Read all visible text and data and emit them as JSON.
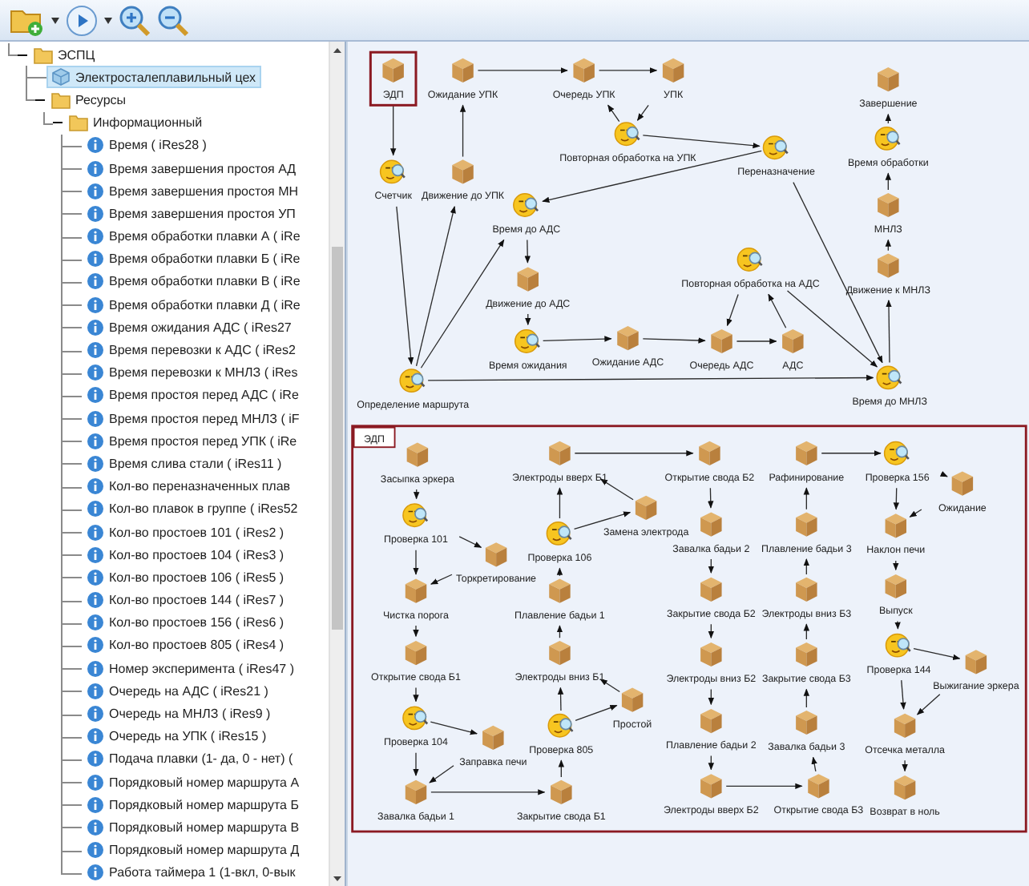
{
  "tree": [
    {
      "label": "ЭСПЦ",
      "kind": "folder",
      "expanded": true,
      "selected": false,
      "children": [
        {
          "label": "Электросталеплавильный цех",
          "kind": "shop",
          "selected": true
        },
        {
          "label": "Ресурсы",
          "kind": "folder",
          "expanded": true,
          "selected": false,
          "children": [
            {
              "label": "Информационный",
              "kind": "folder",
              "expanded": true,
              "selected": false,
              "children": [
                {
                  "label": "Время ( iRes28 )",
                  "kind": "info",
                  "selected": false
                },
                {
                  "label": "Время завершения простоя АД",
                  "kind": "info",
                  "selected": false
                },
                {
                  "label": "Время завершения простоя МН",
                  "kind": "info",
                  "selected": false
                },
                {
                  "label": "Время завершения простоя УП",
                  "kind": "info",
                  "selected": false
                },
                {
                  "label": "Время обработки плавки А ( iRe",
                  "kind": "info",
                  "selected": false
                },
                {
                  "label": "Время обработки плавки Б ( iRe",
                  "kind": "info",
                  "selected": false
                },
                {
                  "label": "Время обработки плавки В ( iRe",
                  "kind": "info",
                  "selected": false
                },
                {
                  "label": "Время обработки плавки Д ( iRe",
                  "kind": "info",
                  "selected": false
                },
                {
                  "label": "Время ожидания АДС ( iRes27",
                  "kind": "info",
                  "selected": false
                },
                {
                  "label": "Время перевозки к АДС ( iRes2",
                  "kind": "info",
                  "selected": false
                },
                {
                  "label": "Время перевозки к МНЛЗ ( iRes",
                  "kind": "info",
                  "selected": false
                },
                {
                  "label": "Время простоя перед АДС ( iRe",
                  "kind": "info",
                  "selected": false
                },
                {
                  "label": "Время простоя перед МНЛЗ ( iF",
                  "kind": "info",
                  "selected": false
                },
                {
                  "label": "Время простоя перед УПК ( iRe",
                  "kind": "info",
                  "selected": false
                },
                {
                  "label": "Время слива стали ( iRes11 )",
                  "kind": "info",
                  "selected": false
                },
                {
                  "label": "Кол-во переназначенных плав",
                  "kind": "info",
                  "selected": false
                },
                {
                  "label": "Кол-во плавок в группе ( iRes52",
                  "kind": "info",
                  "selected": false
                },
                {
                  "label": "Кол-во простоев 101 ( iRes2 )",
                  "kind": "info",
                  "selected": false
                },
                {
                  "label": "Кол-во простоев 104 ( iRes3 )",
                  "kind": "info",
                  "selected": false
                },
                {
                  "label": "Кол-во простоев 106 ( iRes5 )",
                  "kind": "info",
                  "selected": false
                },
                {
                  "label": "Кол-во простоев 144 ( iRes7 )",
                  "kind": "info",
                  "selected": false
                },
                {
                  "label": "Кол-во простоев 156 ( iRes6 )",
                  "kind": "info",
                  "selected": false
                },
                {
                  "label": "Кол-во простоев 805 ( iRes4 )",
                  "kind": "info",
                  "selected": false
                },
                {
                  "label": "Номер эксперимента ( iRes47 )",
                  "kind": "info",
                  "selected": false
                },
                {
                  "label": "Очередь на АДС ( iRes21 )",
                  "kind": "info",
                  "selected": false
                },
                {
                  "label": "Очередь на МНЛЗ ( iRes9 )",
                  "kind": "info",
                  "selected": false
                },
                {
                  "label": "Очередь на УПК ( iRes15 )",
                  "kind": "info",
                  "selected": false
                },
                {
                  "label": "Подача плавки (1- да, 0 - нет) (",
                  "kind": "info",
                  "selected": false
                },
                {
                  "label": "Порядковый номер маршрута А",
                  "kind": "info",
                  "selected": false
                },
                {
                  "label": "Порядковый номер маршрута Б",
                  "kind": "info",
                  "selected": false
                },
                {
                  "label": "Порядковый номер маршрута В",
                  "kind": "info",
                  "selected": false
                },
                {
                  "label": "Порядковый номер маршрута Д",
                  "kind": "info",
                  "selected": false
                },
                {
                  "label": "Работа таймера 1 (1-вкл, 0-вык",
                  "kind": "info",
                  "selected": false
                }
              ]
            }
          ]
        }
      ]
    }
  ],
  "top_diagram": {
    "nodes": [
      {
        "label": "ЭДП",
        "kind": "box",
        "selected": true
      },
      {
        "label": "Ожидание УПК",
        "kind": "box",
        "selected": false
      },
      {
        "label": "Очередь УПК",
        "kind": "box",
        "selected": false
      },
      {
        "label": "УПК",
        "kind": "box",
        "selected": false
      },
      {
        "label": "Повторная обработка на УПК",
        "kind": "check",
        "selected": false
      },
      {
        "label": "Счетчик",
        "kind": "check",
        "selected": false
      },
      {
        "label": "Движение до УПК",
        "kind": "box",
        "selected": false
      },
      {
        "label": "Время до АДС",
        "kind": "check",
        "selected": false
      },
      {
        "label": "Движение до АДС",
        "kind": "box",
        "selected": false
      },
      {
        "label": "Время ожидания",
        "kind": "check",
        "selected": false
      },
      {
        "label": "Ожидание АДС",
        "kind": "box",
        "selected": false
      },
      {
        "label": "Определение маршрута",
        "kind": "check",
        "selected": false
      },
      {
        "label": "Переназначение",
        "kind": "check",
        "selected": false
      },
      {
        "label": "Повторная обработка на АДС",
        "kind": "check",
        "selected": false
      },
      {
        "label": "Очередь АДС",
        "kind": "box",
        "selected": false
      },
      {
        "label": "АДС",
        "kind": "box",
        "selected": false
      },
      {
        "label": "Завершение",
        "kind": "box",
        "selected": false
      },
      {
        "label": "Время обработки",
        "kind": "check",
        "selected": false
      },
      {
        "label": "МНЛЗ",
        "kind": "box",
        "selected": false
      },
      {
        "label": "Движение к МНЛЗ",
        "kind": "box",
        "selected": false
      },
      {
        "label": "Время до МНЛЗ",
        "kind": "check",
        "selected": false
      }
    ]
  },
  "group": {
    "title": "ЭДП",
    "nodes": [
      {
        "label": "Засыпка эркера",
        "kind": "box",
        "selected": false
      },
      {
        "label": "Проверка 101",
        "kind": "check",
        "selected": false
      },
      {
        "label": "Торкретирование",
        "kind": "box",
        "selected": false
      },
      {
        "label": "Чистка порога",
        "kind": "box",
        "selected": false
      },
      {
        "label": "Открытие свода Б1",
        "kind": "box",
        "selected": false
      },
      {
        "label": "Проверка 104",
        "kind": "check",
        "selected": false
      },
      {
        "label": "Заправка печи",
        "kind": "box",
        "selected": false
      },
      {
        "label": "Завалка бадьи 1",
        "kind": "box",
        "selected": false
      },
      {
        "label": "Электроды вверх Б1",
        "kind": "box",
        "selected": false
      },
      {
        "label": "Замена электрода",
        "kind": "box",
        "selected": false
      },
      {
        "label": "Проверка 106",
        "kind": "check",
        "selected": false
      },
      {
        "label": "Плавление бадьи 1",
        "kind": "box",
        "selected": false
      },
      {
        "label": "Электроды вниз Б1",
        "kind": "box",
        "selected": false
      },
      {
        "label": "Простой",
        "kind": "box",
        "selected": false
      },
      {
        "label": "Проверка 805",
        "kind": "check",
        "selected": false
      },
      {
        "label": "Закрытие свода Б1",
        "kind": "box",
        "selected": false
      },
      {
        "label": "Открытие свода Б2",
        "kind": "box",
        "selected": false
      },
      {
        "label": "Завалка бадьи 2",
        "kind": "box",
        "selected": false
      },
      {
        "label": "Закрытие свода Б2",
        "kind": "box",
        "selected": false
      },
      {
        "label": "Электроды вниз Б2",
        "kind": "box",
        "selected": false
      },
      {
        "label": "Плавление бадьи 2",
        "kind": "box",
        "selected": false
      },
      {
        "label": "Электроды вверх Б2",
        "kind": "box",
        "selected": false
      },
      {
        "label": "Рафинирование",
        "kind": "box",
        "selected": false
      },
      {
        "label": "Плавление бадьи 3",
        "kind": "box",
        "selected": false
      },
      {
        "label": "Электроды вниз Б3",
        "kind": "box",
        "selected": false
      },
      {
        "label": "Закрытие свода Б3",
        "kind": "box",
        "selected": false
      },
      {
        "label": "Завалка бадьи 3",
        "kind": "box",
        "selected": false
      },
      {
        "label": "Открытие свода Б3",
        "kind": "box",
        "selected": false
      },
      {
        "label": "Проверка 156",
        "kind": "check",
        "selected": false
      },
      {
        "label": "Ожидание",
        "kind": "box",
        "selected": false
      },
      {
        "label": "Наклон печи",
        "kind": "box",
        "selected": false
      },
      {
        "label": "Выпуск",
        "kind": "box",
        "selected": false
      },
      {
        "label": "Проверка 144",
        "kind": "check",
        "selected": false
      },
      {
        "label": "Выжигание эркера",
        "kind": "box",
        "selected": false
      },
      {
        "label": "Отсечка металла",
        "kind": "box",
        "selected": false
      },
      {
        "label": "Возврат в ноль",
        "kind": "box",
        "selected": false
      }
    ]
  }
}
